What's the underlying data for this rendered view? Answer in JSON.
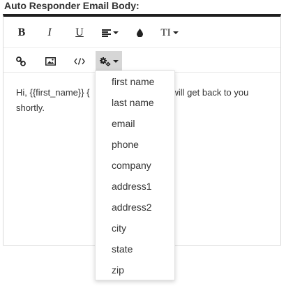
{
  "header": {
    "title": "Auto Responder Email Body:"
  },
  "toolbar": {
    "bold_label": "B",
    "italic_label": "I",
    "underline_label": "U",
    "text_size_label": "TI",
    "icons": [
      "bold-icon",
      "italic-icon",
      "underline-icon",
      "align-icon",
      "color-drop-icon",
      "text-size-icon",
      "link-icon",
      "image-icon",
      "code-icon",
      "settings-icon"
    ]
  },
  "editor": {
    "line1_left": "Hi, {{first_name}} {",
    "line1_right": "will get back to you",
    "line2": "shortly."
  },
  "merge_fields": [
    "first name",
    "last name",
    "email",
    "phone",
    "company",
    "address1",
    "address2",
    "city",
    "state",
    "zip"
  ]
}
